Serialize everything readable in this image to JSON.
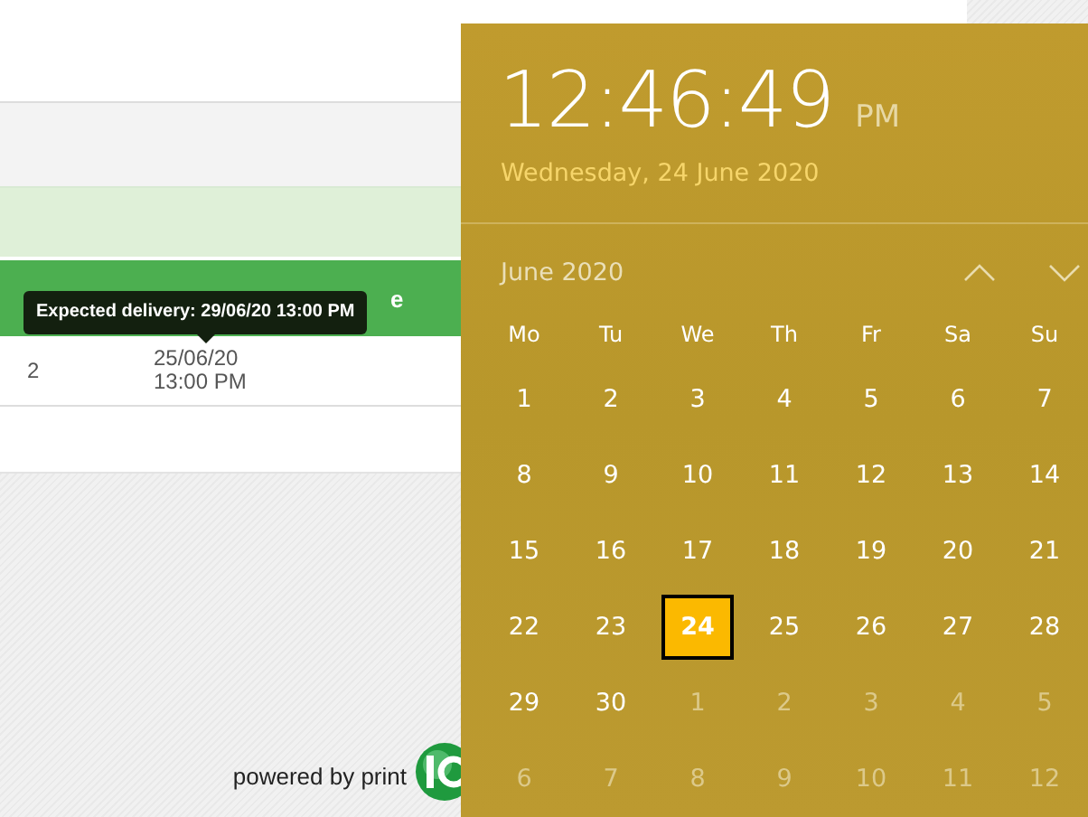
{
  "page": {
    "header_fragment": "e",
    "tooltip": "Expected delivery: 29/06/20 13:00 PM",
    "row": {
      "del_days": "2",
      "ship_date": [
        "25/06/20",
        "13:00 PM"
      ]
    },
    "footer": {
      "text": "powered by print"
    }
  },
  "clock": {
    "time": "12:46:49",
    "period": "PM",
    "date": "Wednesday, 24 June 2020"
  },
  "calendar": {
    "month": "June 2020",
    "weekdays": [
      "Mo",
      "Tu",
      "We",
      "Th",
      "Fr",
      "Sa",
      "Su"
    ],
    "days": [
      {
        "label": "1",
        "in_month": true,
        "selected": false
      },
      {
        "label": "2",
        "in_month": true,
        "selected": false
      },
      {
        "label": "3",
        "in_month": true,
        "selected": false
      },
      {
        "label": "4",
        "in_month": true,
        "selected": false
      },
      {
        "label": "5",
        "in_month": true,
        "selected": false
      },
      {
        "label": "6",
        "in_month": true,
        "selected": false
      },
      {
        "label": "7",
        "in_month": true,
        "selected": false
      },
      {
        "label": "8",
        "in_month": true,
        "selected": false
      },
      {
        "label": "9",
        "in_month": true,
        "selected": false
      },
      {
        "label": "10",
        "in_month": true,
        "selected": false
      },
      {
        "label": "11",
        "in_month": true,
        "selected": false
      },
      {
        "label": "12",
        "in_month": true,
        "selected": false
      },
      {
        "label": "13",
        "in_month": true,
        "selected": false
      },
      {
        "label": "14",
        "in_month": true,
        "selected": false
      },
      {
        "label": "15",
        "in_month": true,
        "selected": false
      },
      {
        "label": "16",
        "in_month": true,
        "selected": false
      },
      {
        "label": "17",
        "in_month": true,
        "selected": false
      },
      {
        "label": "18",
        "in_month": true,
        "selected": false
      },
      {
        "label": "19",
        "in_month": true,
        "selected": false
      },
      {
        "label": "20",
        "in_month": true,
        "selected": false
      },
      {
        "label": "21",
        "in_month": true,
        "selected": false
      },
      {
        "label": "22",
        "in_month": true,
        "selected": false
      },
      {
        "label": "23",
        "in_month": true,
        "selected": false
      },
      {
        "label": "24",
        "in_month": true,
        "selected": true
      },
      {
        "label": "25",
        "in_month": true,
        "selected": false
      },
      {
        "label": "26",
        "in_month": true,
        "selected": false
      },
      {
        "label": "27",
        "in_month": true,
        "selected": false
      },
      {
        "label": "28",
        "in_month": true,
        "selected": false
      },
      {
        "label": "29",
        "in_month": true,
        "selected": false
      },
      {
        "label": "30",
        "in_month": true,
        "selected": false
      },
      {
        "label": "1",
        "in_month": false,
        "selected": false
      },
      {
        "label": "2",
        "in_month": false,
        "selected": false
      },
      {
        "label": "3",
        "in_month": false,
        "selected": false
      },
      {
        "label": "4",
        "in_month": false,
        "selected": false
      },
      {
        "label": "5",
        "in_month": false,
        "selected": false
      },
      {
        "label": "6",
        "in_month": false,
        "selected": false
      },
      {
        "label": "7",
        "in_month": false,
        "selected": false
      },
      {
        "label": "8",
        "in_month": false,
        "selected": false
      },
      {
        "label": "9",
        "in_month": false,
        "selected": false
      },
      {
        "label": "10",
        "in_month": false,
        "selected": false
      },
      {
        "label": "11",
        "in_month": false,
        "selected": false
      },
      {
        "label": "12",
        "in_month": false,
        "selected": false
      }
    ]
  }
}
